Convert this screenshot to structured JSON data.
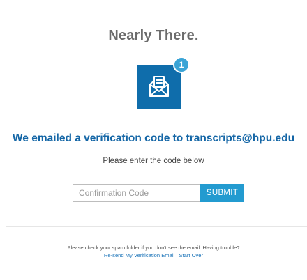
{
  "page": {
    "title": "Nearly There.",
    "badge_count": "1",
    "headline": "We emailed a verification code to transcripts@hpu.edu",
    "instruction": "Please enter the code below"
  },
  "form": {
    "code_placeholder": "Confirmation Code",
    "code_value": "",
    "submit_label": "SUBMIT"
  },
  "footer": {
    "help_text": "Please check your spam folder if you don't see the email. Having trouble?",
    "resend_link": "Re-send My Verification Email",
    "separator": "|",
    "start_over_link": "Start Over"
  },
  "icons": {
    "email": "envelope-letter-icon"
  },
  "colors": {
    "tile": "#0f6dab",
    "badge": "#3aa4d6",
    "headline": "#1466a6",
    "submit": "#239bd0",
    "link": "#1a73b8"
  }
}
